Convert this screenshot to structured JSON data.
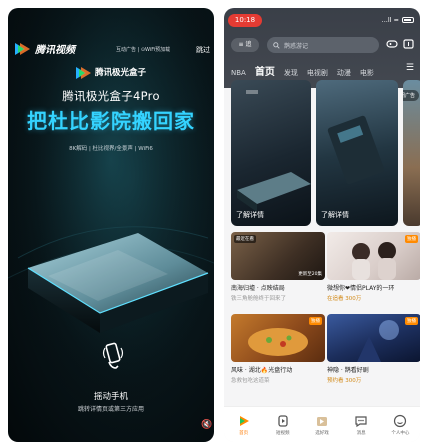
{
  "splash": {
    "app_logo_text": "腾讯视频",
    "ad_tags": "互动广告 | ⊙WiFi预加载",
    "skip_label": "跳过",
    "brand_name": "腾讯极光盒子",
    "product_name": "腾讯极光盒子4Pro",
    "headline": "把杜比影院搬回家",
    "features": "8K解码 | 杜比视界/全景声 | WiFi6",
    "shake_title": "摇动手机",
    "shake_subtitle": "跳转详情页或第三方应用",
    "mute_icon": "speaker-mute-icon",
    "accent_color": "#34d3ff"
  },
  "app": {
    "status": {
      "time": "10:18",
      "icons": "...ll ≈"
    },
    "menu_label": "≡ 追",
    "search_placeholder": "鹊惑游记",
    "header_icons": [
      "gamepad-icon",
      "download-icon"
    ],
    "nav": {
      "tabs": [
        "NBA",
        "首页",
        "发现",
        "电视剧",
        "动漫",
        "电影"
      ],
      "active_index": 1,
      "more_icon": "menu-icon"
    },
    "banners": [
      {
        "caption": "了解详情"
      },
      {
        "caption": "了解详情"
      },
      {
        "close_label": "关闭广告"
      }
    ],
    "cards": [
      {
        "tag": "最近在看",
        "episode": "更新至20集",
        "title": "南海归墟 · 点映结局",
        "subtitle": "铁三角舱舱终于回来了"
      },
      {
        "badge": "独播",
        "title": "微想你❤情侣PLAY的一环",
        "hot": "在追看 300万"
      },
      {
        "badge": "独播",
        "title": "风味 · 湖北🔥光盘行动",
        "subtitle": "急救包吃这道菜"
      },
      {
        "badge": "独播",
        "title": "神隐 · 鹊看好剧",
        "hot": "预约看 300万"
      }
    ],
    "tabbar": [
      {
        "label": "首页",
        "icon": "home-icon",
        "active": true
      },
      {
        "label": "短视频",
        "icon": "short-video-icon",
        "active": false
      },
      {
        "label": "选好戏",
        "icon": "movie-board-icon",
        "active": false
      },
      {
        "label": "消息",
        "icon": "message-icon",
        "active": false
      },
      {
        "label": "个人中心",
        "icon": "profile-icon",
        "active": false
      }
    ]
  }
}
